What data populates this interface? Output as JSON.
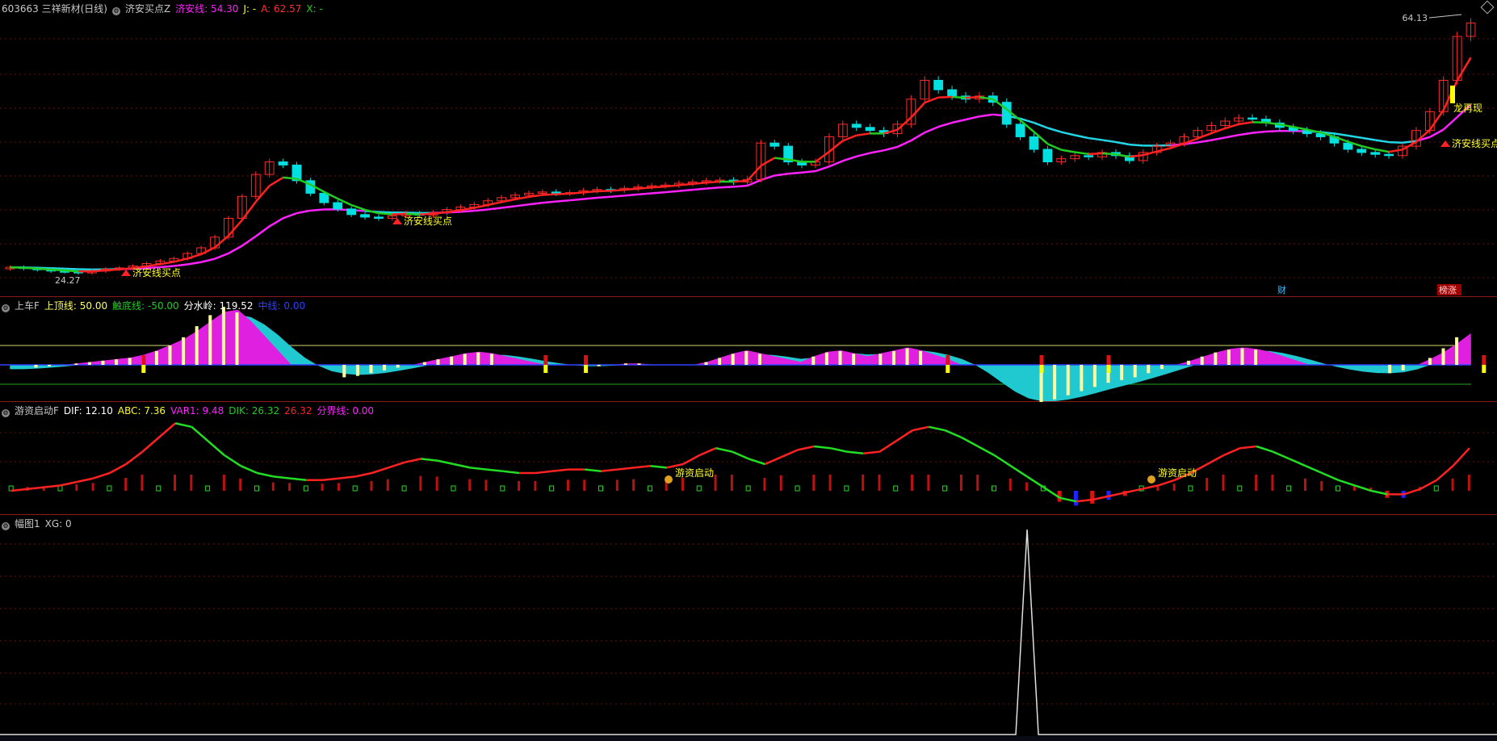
{
  "main": {
    "stock": "603663 三祥新材(日线)",
    "indicator": "济安买点Z",
    "v1_label": "济安线: 54.30",
    "v2_label": "J: -",
    "v3_label": "A: 62.57",
    "v4_label": "X: -",
    "high_label": "64.13",
    "low_label": "24.27",
    "buy_label": "济安线买点",
    "dragon_label": "龙再现",
    "cai_label": "财",
    "bangzhang_label": "榜涨",
    "colors": {
      "up": "#ff2a2a",
      "down": "#00e0e0",
      "magenta": "#ff22ff",
      "cyan": "#22d6e6",
      "green": "#22cc22",
      "red": "#ff2222",
      "yellow": "#ffff00"
    }
  },
  "p2": {
    "title": "上车F",
    "v1": "上顶线: 50.00",
    "v2": "触底线: -50.00",
    "v3": "分水岭: 119.52",
    "v4": "中线: 0.00"
  },
  "p3": {
    "title": "游资启动F",
    "v1": "DIF: 12.10",
    "v2": "ABC: 7.36",
    "v3": "VAR1: 9.48",
    "v4": "DIK: 26.32",
    "v5": "26.32",
    "v6": "分界线: 0.00",
    "start_label": "游资启动"
  },
  "p4": {
    "title": "幅图1",
    "v1": "XG: 0"
  },
  "chart_data": [
    {
      "type": "line",
      "name": "price",
      "x_count": 90,
      "high": 64.13,
      "low": 24.27,
      "close": [
        25.2,
        25.0,
        24.8,
        24.6,
        24.5,
        24.3,
        24.6,
        24.9,
        25.1,
        25.4,
        25.8,
        26.2,
        26.6,
        27.4,
        28.3,
        30.0,
        33.0,
        36.5,
        40.0,
        42.0,
        41.5,
        39.0,
        37.0,
        35.5,
        34.5,
        33.6,
        33.2,
        33.0,
        33.4,
        33.8,
        33.5,
        33.9,
        34.4,
        34.8,
        35.2,
        35.8,
        36.3,
        36.7,
        37.0,
        37.2,
        37.0,
        37.1,
        37.4,
        37.6,
        37.5,
        37.8,
        38.0,
        38.2,
        38.3,
        38.6,
        38.8,
        39.0,
        39.1,
        38.8,
        39.2,
        45.0,
        44.5,
        42.0,
        41.5,
        42.0,
        46.0,
        48.0,
        47.5,
        47.0,
        46.5,
        48.0,
        52.0,
        55.0,
        53.5,
        52.5,
        52.0,
        52.5,
        51.5,
        48.0,
        46.0,
        44.0,
        42.0,
        42.5,
        43.0,
        42.8,
        43.5,
        43.0,
        42.2,
        43.5,
        44.5,
        45.0,
        46.0,
        47.0,
        47.8,
        48.5,
        49.0,
        48.8,
        48.2,
        47.5,
        47.0,
        46.5,
        46.0,
        45.0,
        44.0,
        43.5,
        43.2,
        43.0,
        44.5,
        47.0,
        50.0,
        55.0,
        62.0,
        64.13
      ]
    },
    {
      "type": "area",
      "name": "上车F",
      "values": [
        -3,
        -3,
        -2,
        -1,
        0,
        1,
        2,
        3,
        4,
        5,
        7,
        10,
        14,
        20,
        28,
        36,
        42,
        38,
        30,
        20,
        10,
        0,
        -6,
        -9,
        -10,
        -9,
        -8,
        -6,
        -4,
        -2,
        0,
        2,
        4,
        6,
        8,
        9,
        8,
        6,
        4,
        2,
        0,
        -1,
        -2,
        -2,
        -1,
        0,
        1,
        1,
        0,
        0,
        -1,
        0,
        2,
        5,
        8,
        10,
        8,
        6,
        4,
        2,
        6,
        9,
        10,
        8,
        6,
        8,
        10,
        12,
        10,
        7,
        4,
        0,
        -6,
        -14,
        -22,
        -28,
        -30,
        -28,
        -25,
        -22,
        -19,
        -16,
        -13,
        -11,
        -9,
        -6,
        -3,
        0,
        3,
        6,
        9,
        11,
        12,
        11,
        9,
        6,
        3,
        0,
        -3,
        -5,
        -6,
        -7,
        -7,
        -6,
        -4,
        0,
        5,
        12,
        20,
        28
      ]
    },
    {
      "type": "line",
      "name": "游资启动F",
      "values": [
        0,
        1,
        2,
        3,
        5,
        7,
        10,
        15,
        22,
        30,
        38,
        36,
        28,
        20,
        14,
        10,
        8,
        7,
        6,
        6,
        7,
        8,
        10,
        13,
        16,
        18,
        17,
        15,
        13,
        12,
        11,
        10,
        10,
        11,
        12,
        12,
        11,
        12,
        13,
        14,
        13,
        15,
        20,
        24,
        22,
        18,
        15,
        19,
        23,
        25,
        24,
        22,
        21,
        22,
        28,
        34,
        36,
        34,
        30,
        25,
        20,
        14,
        8,
        2,
        -4,
        -6,
        -5,
        -3,
        -1,
        1,
        3,
        6,
        10,
        15,
        20,
        24,
        25,
        22,
        18,
        14,
        10,
        6,
        3,
        0,
        -2,
        -2,
        1,
        6,
        14,
        24
      ]
    },
    {
      "type": "line",
      "name": "幅图1 XG",
      "spike_index": 62,
      "values_note": "single spike"
    }
  ]
}
